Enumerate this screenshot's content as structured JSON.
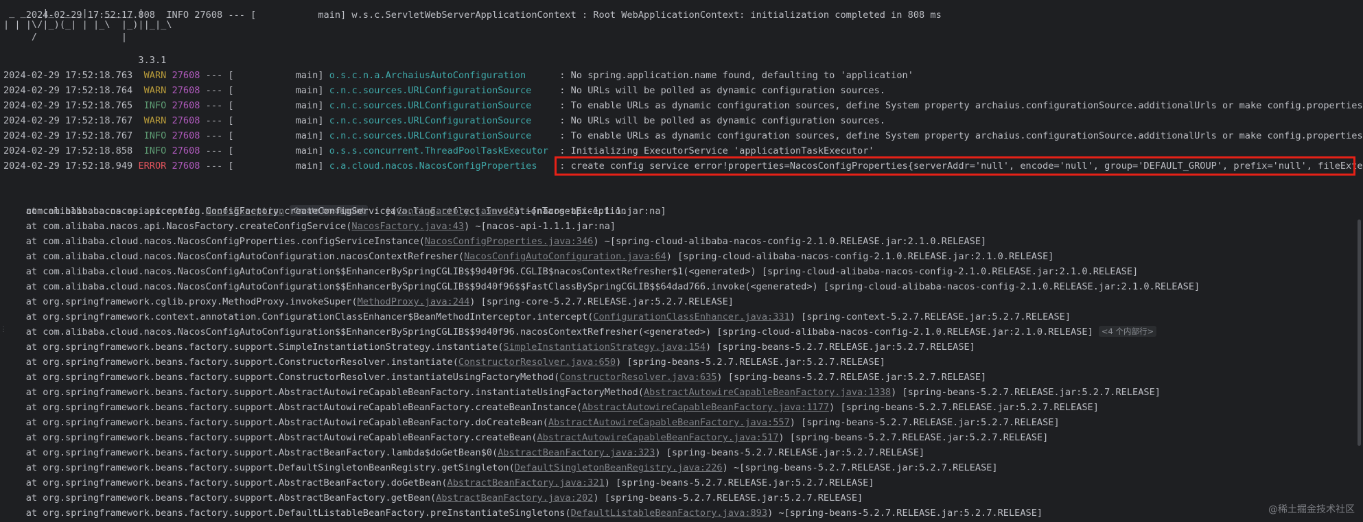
{
  "banner": {
    "line0": "2024-02-29 17:52:17.808  INFO 27608 --- [           main] w.s.c.ServletWebServerApplicationContext : Root WebApplicationContext: initialization completed in 808 ms",
    "art1": " _ _   |_  _ _|_. ___ _ |    _ ",
    "art2": "| | |\\/|_)(_| | |_\\  |_)||_|_\\ ",
    "art3": "     /               |",
    "version": "                        3.3.1"
  },
  "log_lines": [
    {
      "ts": "2024-02-29 17:52:18.763",
      "level": "WARN",
      "pid": "27608",
      "thread": "--- [           main]",
      "logger": "o.s.c.n.a.ArchaiusAutoConfiguration     ",
      "msg": " : No spring.application.name found, defaulting to 'application'"
    },
    {
      "ts": "2024-02-29 17:52:18.764",
      "level": "WARN",
      "pid": "27608",
      "thread": "--- [           main]",
      "logger": "c.n.c.sources.URLConfigurationSource    ",
      "msg": " : No URLs will be polled as dynamic configuration sources."
    },
    {
      "ts": "2024-02-29 17:52:18.765",
      "level": "INFO",
      "pid": "27608",
      "thread": "--- [           main]",
      "logger": "c.n.c.sources.URLConfigurationSource    ",
      "msg": " : To enable URLs as dynamic configuration sources, define System property archaius.configurationSource.additionalUrls or make config.properties avail"
    },
    {
      "ts": "2024-02-29 17:52:18.767",
      "level": "WARN",
      "pid": "27608",
      "thread": "--- [           main]",
      "logger": "c.n.c.sources.URLConfigurationSource    ",
      "msg": " : No URLs will be polled as dynamic configuration sources."
    },
    {
      "ts": "2024-02-29 17:52:18.767",
      "level": "INFO",
      "pid": "27608",
      "thread": "--- [           main]",
      "logger": "c.n.c.sources.URLConfigurationSource    ",
      "msg": " : To enable URLs as dynamic configuration sources, define System property archaius.configurationSource.additionalUrls or make config.properties avail"
    },
    {
      "ts": "2024-02-29 17:52:18.858",
      "level": "INFO",
      "pid": "27608",
      "thread": "--- [           main]",
      "logger": "o.s.s.concurrent.ThreadPoolTaskExecutor ",
      "msg": " : Initializing ExecutorService 'applicationTaskExecutor'"
    },
    {
      "ts": "2024-02-29 17:52:18.949",
      "level": "ERROR",
      "pid": "27608",
      "thread": "--- [           main]",
      "logger": "c.a.cloud.nacos.NacosConfigProperties   ",
      "msg": " : create config service error!properties=NacosConfigProperties{serverAddr='null', encode='null', group='DEFAULT_GROUP', prefix='null', fileExtension="
    }
  ],
  "exception": {
    "prefix": "com.alibaba.nacos.api.exception.",
    "class_link": "NacosException",
    "breakpoint_chip": "Create breakpoint",
    "message": " : java.lang.reflect.InvocationTargetException"
  },
  "stack": [
    {
      "pre": "    at com.alibaba.nacos.api.config.ConfigFactory.createConfigService(",
      "link": "ConfigFactory.java:45",
      "post": ") ~[nacos-api-1.1.1.jar:na]"
    },
    {
      "pre": "    at com.alibaba.nacos.api.NacosFactory.createConfigService(",
      "link": "NacosFactory.java:43",
      "post": ") ~[nacos-api-1.1.1.jar:na]"
    },
    {
      "pre": "    at com.alibaba.cloud.nacos.NacosConfigProperties.configServiceInstance(",
      "link": "NacosConfigProperties.java:346",
      "post": ") ~[spring-cloud-alibaba-nacos-config-2.1.0.RELEASE.jar:2.1.0.RELEASE]"
    },
    {
      "pre": "    at com.alibaba.cloud.nacos.NacosConfigAutoConfiguration.nacosContextRefresher(",
      "link": "NacosConfigAutoConfiguration.java:64",
      "post": ") [spring-cloud-alibaba-nacos-config-2.1.0.RELEASE.jar:2.1.0.RELEASE]"
    },
    {
      "pre": "    at com.alibaba.cloud.nacos.NacosConfigAutoConfiguration$$EnhancerBySpringCGLIB$$9d40f96.CGLIB$nacosContextRefresher$1(<generated>) [spring-cloud-alibaba-nacos-config-2.1.0.RELEASE.jar:2.1.0.RELEASE]",
      "link": "",
      "post": ""
    },
    {
      "pre": "    at com.alibaba.cloud.nacos.NacosConfigAutoConfiguration$$EnhancerBySpringCGLIB$$9d40f96$$FastClassBySpringCGLIB$$64dad766.invoke(<generated>) [spring-cloud-alibaba-nacos-config-2.1.0.RELEASE.jar:2.1.0.RELEASE]",
      "link": "",
      "post": ""
    },
    {
      "pre": "    at org.springframework.cglib.proxy.MethodProxy.invokeSuper(",
      "link": "MethodProxy.java:244",
      "post": ") [spring-core-5.2.7.RELEASE.jar:5.2.7.RELEASE]"
    },
    {
      "pre": "    at org.springframework.context.annotation.ConfigurationClassEnhancer$BeanMethodInterceptor.intercept(",
      "link": "ConfigurationClassEnhancer.java:331",
      "post": ") [spring-context-5.2.7.RELEASE.jar:5.2.7.RELEASE]"
    },
    {
      "pre": "    at com.alibaba.cloud.nacos.NacosConfigAutoConfiguration$$EnhancerBySpringCGLIB$$9d40f96.nacosContextRefresher(<generated>) [spring-cloud-alibaba-nacos-config-2.1.0.RELEASE.jar:2.1.0.RELEASE]",
      "link": "",
      "post": "",
      "fold": "<4 个内部行>"
    },
    {
      "pre": "    at org.springframework.beans.factory.support.SimpleInstantiationStrategy.instantiate(",
      "link": "SimpleInstantiationStrategy.java:154",
      "post": ") [spring-beans-5.2.7.RELEASE.jar:5.2.7.RELEASE]"
    },
    {
      "pre": "    at org.springframework.beans.factory.support.ConstructorResolver.instantiate(",
      "link": "ConstructorResolver.java:650",
      "post": ") [spring-beans-5.2.7.RELEASE.jar:5.2.7.RELEASE]"
    },
    {
      "pre": "    at org.springframework.beans.factory.support.ConstructorResolver.instantiateUsingFactoryMethod(",
      "link": "ConstructorResolver.java:635",
      "post": ") [spring-beans-5.2.7.RELEASE.jar:5.2.7.RELEASE]"
    },
    {
      "pre": "    at org.springframework.beans.factory.support.AbstractAutowireCapableBeanFactory.instantiateUsingFactoryMethod(",
      "link": "AbstractAutowireCapableBeanFactory.java:1338",
      "post": ") [spring-beans-5.2.7.RELEASE.jar:5.2.7.RELEASE]"
    },
    {
      "pre": "    at org.springframework.beans.factory.support.AbstractAutowireCapableBeanFactory.createBeanInstance(",
      "link": "AbstractAutowireCapableBeanFactory.java:1177",
      "post": ") [spring-beans-5.2.7.RELEASE.jar:5.2.7.RELEASE]"
    },
    {
      "pre": "    at org.springframework.beans.factory.support.AbstractAutowireCapableBeanFactory.doCreateBean(",
      "link": "AbstractAutowireCapableBeanFactory.java:557",
      "post": ") [spring-beans-5.2.7.RELEASE.jar:5.2.7.RELEASE]"
    },
    {
      "pre": "    at org.springframework.beans.factory.support.AbstractAutowireCapableBeanFactory.createBean(",
      "link": "AbstractAutowireCapableBeanFactory.java:517",
      "post": ") [spring-beans-5.2.7.RELEASE.jar:5.2.7.RELEASE]"
    },
    {
      "pre": "    at org.springframework.beans.factory.support.AbstractBeanFactory.lambda$doGetBean$0(",
      "link": "AbstractBeanFactory.java:323",
      "post": ") [spring-beans-5.2.7.RELEASE.jar:5.2.7.RELEASE]"
    },
    {
      "pre": "    at org.springframework.beans.factory.support.DefaultSingletonBeanRegistry.getSingleton(",
      "link": "DefaultSingletonBeanRegistry.java:226",
      "post": ") ~[spring-beans-5.2.7.RELEASE.jar:5.2.7.RELEASE]"
    },
    {
      "pre": "    at org.springframework.beans.factory.support.AbstractBeanFactory.doGetBean(",
      "link": "AbstractBeanFactory.java:321",
      "post": ") [spring-beans-5.2.7.RELEASE.jar:5.2.7.RELEASE]"
    },
    {
      "pre": "    at org.springframework.beans.factory.support.AbstractBeanFactory.getBean(",
      "link": "AbstractBeanFactory.java:202",
      "post": ") [spring-beans-5.2.7.RELEASE.jar:5.2.7.RELEASE]"
    },
    {
      "pre": "    at org.springframework.beans.factory.support.DefaultListableBeanFactory.preInstantiateSingletons(",
      "link": "DefaultListableBeanFactory.java:893",
      "post": ") ~[spring-beans-5.2.7.RELEASE.jar:5.2.7.RELEASE]"
    }
  ],
  "watermark": "@稀土掘金技术社区",
  "colors": {
    "background": "#1e1f22",
    "text": "#bcbec4",
    "warn": "#b89b3a",
    "info": "#5f9e75",
    "error": "#e0545c",
    "pid": "#b25bbf",
    "logger": "#3fa7a8",
    "highlight": "#e62117"
  }
}
